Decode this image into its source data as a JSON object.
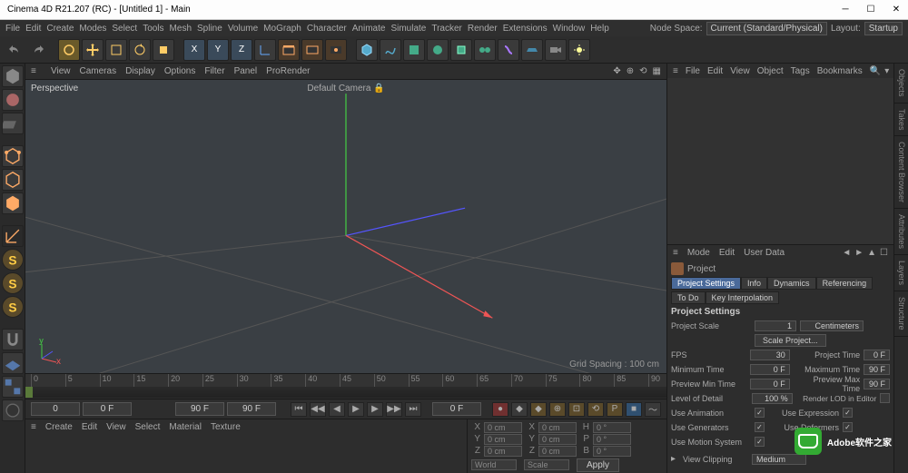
{
  "title": "Cinema 4D R21.207 (RC) - [Untitled 1] - Main",
  "menu": [
    "File",
    "Edit",
    "Create",
    "Modes",
    "Select",
    "Tools",
    "Mesh",
    "Spline",
    "Volume",
    "MoGraph",
    "Character",
    "Animate",
    "Simulate",
    "Tracker",
    "Render",
    "Extensions",
    "Window",
    "Help"
  ],
  "nodespace_label": "Node Space:",
  "nodespace_value": "Current (Standard/Physical)",
  "layout_label": "Layout:",
  "layout_value": "Startup",
  "vp_menu": [
    "View",
    "Cameras",
    "Display",
    "Options",
    "Filter",
    "Panel",
    "ProRender"
  ],
  "vp_persp": "Perspective",
  "vp_cam": "Default Camera",
  "vp_grid": "Grid Spacing : 100 cm",
  "timeline": {
    "start": 0,
    "end": 90,
    "step": 5
  },
  "transport": {
    "f0": "0",
    "f1": "0 F",
    "f2": "90 F",
    "f3": "90 F",
    "f4": "0 F"
  },
  "mat_menu": [
    "Create",
    "Edit",
    "View",
    "Select",
    "Material",
    "Texture"
  ],
  "coord": {
    "labels": [
      "X",
      "Y",
      "Z"
    ],
    "pos": [
      "0 cm",
      "0 cm",
      "0 cm"
    ],
    "size": [
      "0 cm",
      "0 cm",
      "0 cm"
    ],
    "rot": [
      "H",
      "P",
      "B"
    ],
    "rotv": [
      "0 °",
      "0 °",
      "0 °"
    ],
    "mode1": "World",
    "mode2": "Scale",
    "apply": "Apply"
  },
  "om_menu": [
    "File",
    "Edit",
    "View",
    "Object",
    "Tags",
    "Bookmarks"
  ],
  "attr_menu": [
    "Mode",
    "Edit",
    "User Data"
  ],
  "attr": {
    "obj": "Project",
    "tabs1": [
      "Project Settings",
      "Info",
      "Dynamics",
      "Referencing"
    ],
    "tabs2": [
      "To Do",
      "Key Interpolation"
    ],
    "section": "Project Settings",
    "scale_lab": "Project Scale",
    "scale_val": "1",
    "scale_unit": "Centimeters",
    "scale_btn": "Scale Project...",
    "fps_lab": "FPS",
    "fps_val": "30",
    "ptime_lab": "Project Time",
    "ptime_val": "0 F",
    "min_lab": "Minimum Time",
    "min_val": "0 F",
    "max_lab": "Maximum Time",
    "max_val": "90 F",
    "pmin_lab": "Preview Min Time",
    "pmin_val": "0 F",
    "pmax_lab": "Preview Max Time",
    "pmax_val": "90 F",
    "lod_lab": "Level of Detail",
    "lod_val": "100 %",
    "lod2_lab": "Render LOD in Editor",
    "anim_lab": "Use Animation",
    "expr_lab": "Use Expression",
    "gen_lab": "Use Generators",
    "def_lab": "Use Deformers",
    "mot_lab": "Use Motion System",
    "clip_lab": "View Clipping",
    "clip_val": "Medium"
  },
  "rtabs": [
    "Objects",
    "Takes",
    "Content Browser",
    "Attributes",
    "Layers",
    "Structure"
  ],
  "watermark": "Adobe软件之家"
}
